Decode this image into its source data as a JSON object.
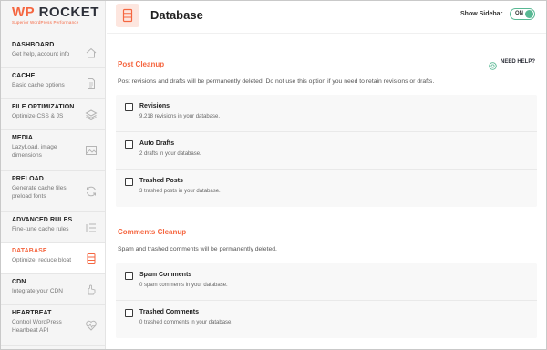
{
  "brand": {
    "logo_prefix": "WP",
    "logo_main": "ROCKET",
    "logo_tagline": "Superior WordPress Performance"
  },
  "sidebar": {
    "items": [
      {
        "title": "Dashboard",
        "desc": "Get help, account info",
        "icon": "house-icon"
      },
      {
        "title": "Cache",
        "desc": "Basic cache options",
        "icon": "document-icon"
      },
      {
        "title": "File Optimization",
        "desc": "Optimize CSS & JS",
        "icon": "layers-icon"
      },
      {
        "title": "Media",
        "desc": "LazyLoad, image dimensions",
        "icon": "image-icon"
      },
      {
        "title": "Preload",
        "desc": "Generate cache files, preload fonts",
        "icon": "refresh-icon"
      },
      {
        "title": "Advanced Rules",
        "desc": "Fine-tune cache rules",
        "icon": "list-icon"
      },
      {
        "title": "Database",
        "desc": "Optimize, reduce bloat",
        "icon": "database-icon"
      },
      {
        "title": "CDN",
        "desc": "Integrate your CDN",
        "icon": "hand-icon"
      },
      {
        "title": "Heartbeat",
        "desc": "Control WordPress Heartbeat API",
        "icon": "heartbeat-icon"
      }
    ],
    "active_index": 6
  },
  "header": {
    "title": "Database",
    "show_sidebar_label": "Show Sidebar",
    "toggle_label": "ON"
  },
  "post_cleanup": {
    "title": "Post Cleanup",
    "need_help": "NEED HELP?",
    "description": "Post revisions and drafts will be permanently deleted. Do not use this option if you need to retain revisions or drafts.",
    "options": [
      {
        "label": "Revisions",
        "desc": "9,218 revisions in your database."
      },
      {
        "label": "Auto Drafts",
        "desc": "2 drafts in your database."
      },
      {
        "label": "Trashed Posts",
        "desc": "3 trashed posts in your database."
      }
    ]
  },
  "comments_cleanup": {
    "title": "Comments Cleanup",
    "description": "Spam and trashed comments will be permanently deleted.",
    "options": [
      {
        "label": "Spam Comments",
        "desc": "0 spam comments in your database."
      },
      {
        "label": "Trashed Comments",
        "desc": "0 trashed comments in your database."
      }
    ]
  },
  "colors": {
    "accent": "#f56640",
    "toggle_on": "#58b893",
    "sidebar_bg": "#f5f5f5",
    "box_bg": "#f8f8f8"
  }
}
